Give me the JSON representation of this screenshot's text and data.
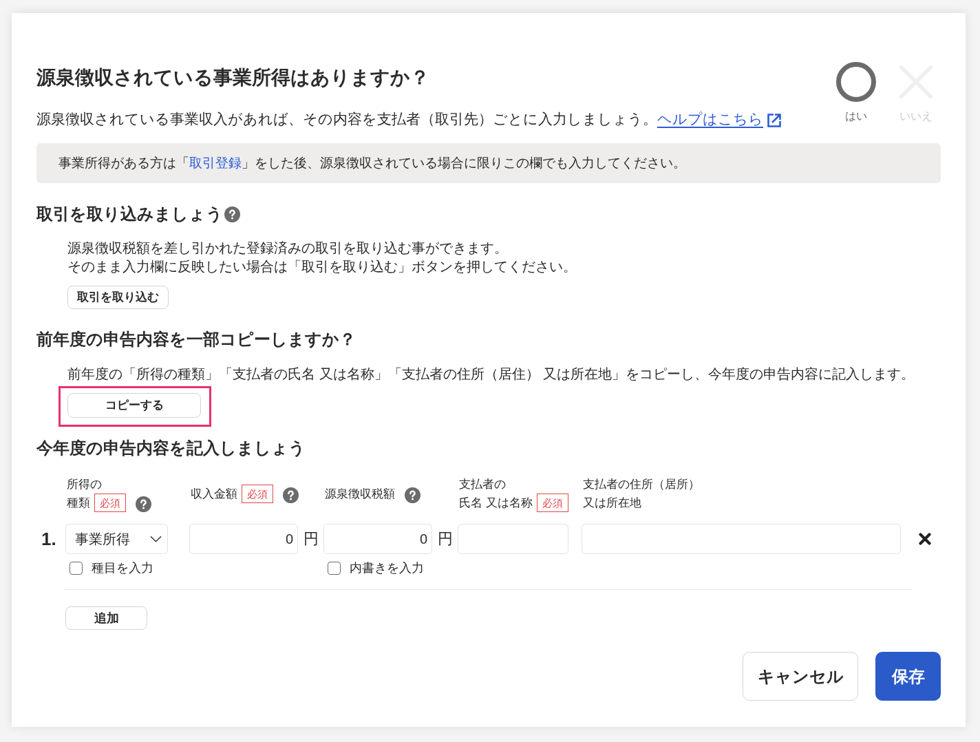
{
  "question": {
    "title": "源泉徴収されている事業所得はありますか？",
    "description": "源泉徴収されている事業収入があれば、その内容を支払者（取引先）ごとに入力しましょう。",
    "help_link": "ヘルプはこちら",
    "answers": [
      {
        "kind": "yes",
        "label": "はい",
        "selected": true
      },
      {
        "kind": "no",
        "label": "いいえ",
        "selected": false
      }
    ]
  },
  "notice": {
    "before": "事業所得がある方は「",
    "link": "取引登録",
    "after": "」をした後、源泉徴収されている場合に限りこの欄でも入力してください。"
  },
  "import_section": {
    "title": "取引を取り込みましょう",
    "help": true,
    "lines": [
      "源泉徴収税額を差し引かれた登録済みの取引を取り込む事ができます。",
      "そのまま入力欄に反映したい場合は「取引を取り込む」ボタンを押してください。"
    ],
    "button": "取引を取り込む"
  },
  "copy_section": {
    "title": "前年度の申告内容を一部コピーしますか？",
    "text": "前年度の「所得の種類」「支払者の氏名 又は名称」「支払者の住所（居住） 又は所在地」をコピーし、今年度の申告内容に記入します。",
    "button": {
      "label": "コピーする",
      "highlighted": true
    }
  },
  "entry_section": {
    "title": "今年度の申告内容を記入しましょう",
    "columns": [
      {
        "lines": [
          "所得の",
          "種類"
        ],
        "badge": "必須",
        "help": true
      },
      {
        "lines": [
          "収入金額"
        ],
        "badge": "必須",
        "help": true
      },
      {
        "lines": [
          "源泉徴収税額"
        ],
        "help": true
      },
      {
        "lines": [
          "支払者の",
          "氏名 又は名称"
        ],
        "badge": "必須",
        "help": false
      },
      {
        "lines": [
          "支払者の住所（居所）",
          "又は所在地"
        ],
        "help": false
      }
    ],
    "rows": [
      {
        "number": "1.",
        "fields": [
          {
            "kind": "select",
            "value": "事業所得",
            "checkbox": {
              "label": "種目を入力",
              "checked": false
            }
          },
          {
            "kind": "amount",
            "value": "0",
            "unit": "円"
          },
          {
            "kind": "amount",
            "value": "0",
            "unit": "円",
            "checkbox": {
              "label": "内書きを入力",
              "checked": false
            }
          },
          {
            "kind": "text"
          },
          {
            "kind": "text"
          }
        ]
      }
    ],
    "add_button": "追加"
  },
  "footer": {
    "cancel": "キャンセル",
    "save": "保存"
  }
}
